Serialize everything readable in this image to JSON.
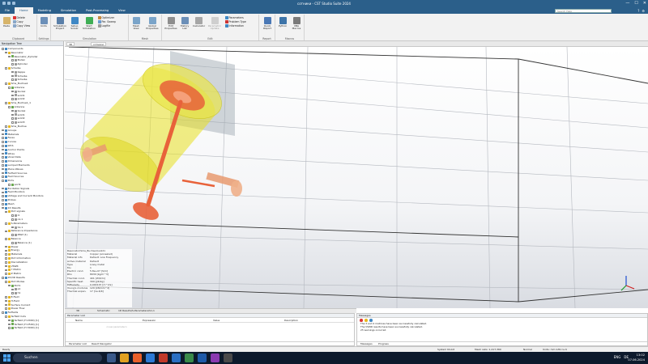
{
  "titlebar": {
    "title": "сотники - CST Studio Suite 2024",
    "minimize": "—",
    "maximize": "☐",
    "close": "✕"
  },
  "menu": {
    "items": [
      "File",
      "Home",
      "Modeling",
      "Simulation",
      "Post-Processing",
      "View"
    ],
    "active_index": 1,
    "search_placeholder": "Search Help"
  },
  "ribbon": {
    "groups": {
      "clipboard": {
        "label": "Clipboard",
        "paste": "Paste",
        "delete": "Delete",
        "copy": "Copy",
        "copy_view": "Copy View"
      },
      "settings": {
        "label": "Settings",
        "units": "Units"
      },
      "simulation": {
        "label": "Simulation",
        "project": "Simulation Project",
        "setup_solver": "Setup Solver",
        "start_simulation": "Start Simulation",
        "optimizer": "Optimizer",
        "par_sweep": "Par. Sweep",
        "logfile": "Logfile"
      },
      "mesh": {
        "label": "Mesh",
        "mesh_view": "Mesh View",
        "global_properties": "Global Properties"
      },
      "edit": {
        "label": "Edit",
        "edit_properties": "Edit Properties",
        "history_list": "History List",
        "calculator": "Calculator",
        "parametric_update": "Parametric Update",
        "parameters": "Parameters",
        "problem_type": "Problem Type",
        "information": "Information"
      },
      "report": {
        "label": "Report",
        "quick_report": "Quick Report"
      },
      "macros": {
        "label": "Macros",
        "python": "Python",
        "vba_macros": "VBA Macros"
      }
    }
  },
  "navtree": {
    "header": "Navigation Tree",
    "items": [
      {
        "label": "Components",
        "depth": 0
      },
      {
        "label": "Resonator",
        "depth": 1
      },
      {
        "label": "Resonator_Zylinder",
        "depth": 2
      },
      {
        "label": "Boden",
        "depth": 3
      },
      {
        "label": "Zylinder",
        "depth": 3
      },
      {
        "label": "Scheibe",
        "depth": 1
      },
      {
        "label": "Kappe",
        "depth": 3
      },
      {
        "label": "Scheibe",
        "depth": 3
      },
      {
        "label": "Scheibe",
        "depth": 3
      },
      {
        "label": "Sma_Buchse1",
        "depth": 1
      },
      {
        "label": "Antenne",
        "depth": 2
      },
      {
        "label": "Sockel",
        "depth": 3
      },
      {
        "label": "solid1",
        "depth": 3
      },
      {
        "label": "solid2",
        "depth": 3
      },
      {
        "label": "Sma_Buchse1_1",
        "depth": 1
      },
      {
        "label": "Antenne",
        "depth": 2
      },
      {
        "label": "Sockel",
        "depth": 3
      },
      {
        "label": "solid1",
        "depth": 3
      },
      {
        "label": "solid2",
        "depth": 3
      },
      {
        "label": "solid3",
        "depth": 3
      },
      {
        "label": "Sma_Buchse",
        "depth": 1
      },
      {
        "label": "Groups",
        "depth": 0
      },
      {
        "label": "Materials",
        "depth": 0
      },
      {
        "label": "Faces",
        "depth": 0
      },
      {
        "label": "Curves",
        "depth": 0
      },
      {
        "label": "WCS",
        "depth": 0
      },
      {
        "label": "Anchor Points",
        "depth": 0
      },
      {
        "label": "Wires",
        "depth": 0
      },
      {
        "label": "Voxel Data",
        "depth": 0
      },
      {
        "label": "Dimensions",
        "depth": 0
      },
      {
        "label": "Lumped Elements",
        "depth": 0
      },
      {
        "label": "Plane Waves",
        "depth": 0
      },
      {
        "label": "Farfield Sources",
        "depth": 0
      },
      {
        "label": "Field Sources",
        "depth": 0
      },
      {
        "label": "Ports",
        "depth": 0
      },
      {
        "label": "port1",
        "depth": 2
      },
      {
        "label": "Excitation Signals",
        "depth": 0
      },
      {
        "label": "Field Monitors",
        "depth": 0
      },
      {
        "label": "Voltage and Current Monitors",
        "depth": 0
      },
      {
        "label": "Probes",
        "depth": 0
      },
      {
        "label": "Mesh",
        "depth": 0
      },
      {
        "label": "1D Results",
        "depth": 0
      },
      {
        "label": "Port signals",
        "depth": 1
      },
      {
        "label": "i1",
        "depth": 3
      },
      {
        "label": "o1,1",
        "depth": 3
      },
      {
        "label": "S-Parameters",
        "depth": 1
      },
      {
        "label": "S1,1",
        "depth": 3
      },
      {
        "label": "Reference Impedance",
        "depth": 1
      },
      {
        "label": "ZRef (1)",
        "depth": 3
      },
      {
        "label": "Balance",
        "depth": 1
      },
      {
        "label": "Balance (1)",
        "depth": 3
      },
      {
        "label": "Power",
        "depth": 1
      },
      {
        "label": "Energy",
        "depth": 1
      },
      {
        "label": "Materials",
        "depth": 1
      },
      {
        "label": "Port Information",
        "depth": 1
      },
      {
        "label": "Discretization",
        "depth": 1
      },
      {
        "label": "VSWR",
        "depth": 1
      },
      {
        "label": "Y Matrix",
        "depth": 1
      },
      {
        "label": "Z Matrix",
        "depth": 1
      },
      {
        "label": "2D/3D Results",
        "depth": 0
      },
      {
        "label": "Port Modes",
        "depth": 1
      },
      {
        "label": "Port1",
        "depth": 2
      },
      {
        "label": "e1",
        "depth": 3
      },
      {
        "label": "h1",
        "depth": 3
      },
      {
        "label": "E-Field",
        "depth": 1
      },
      {
        "label": "H-Field",
        "depth": 1
      },
      {
        "label": "Surface Current",
        "depth": 1
      },
      {
        "label": "Power Flow",
        "depth": 1
      },
      {
        "label": "Farfields",
        "depth": 0
      },
      {
        "label": "farfield Cuts",
        "depth": 1
      },
      {
        "label": "farfield (f=2000) [1]",
        "depth": 2
      },
      {
        "label": "farfield (f=2500) [1]",
        "depth": 2
      },
      {
        "label": "farfield (f=3000) [1]",
        "depth": 2
      }
    ]
  },
  "viewtabs": [
    "3D",
    "сотники"
  ],
  "properties": {
    "path": "Resonator\\Sma_Buchse1\\solid1",
    "rows": [
      {
        "k": "Material",
        "v": "Copper (annealed)"
      },
      {
        "k": "Material info",
        "v": "Default: Low Frequency"
      },
      {
        "k": "Active material",
        "v": "Default"
      },
      {
        "k": "Type",
        "v": "Lossy metal"
      },
      {
        "k": "Mu",
        "v": "1"
      },
      {
        "k": "Electric cond.",
        "v": "5.8e+07 [S/m]"
      },
      {
        "k": "Rho",
        "v": "8930 [kg/m^3]"
      },
      {
        "k": "Thermal cond.",
        "v": "401 [W/K/m]"
      },
      {
        "k": "Specific heat",
        "v": "390 [J/K/kg]"
      },
      {
        "k": "Diffusivity",
        "v": "0.000115 [m^2/s]"
      },
      {
        "k": "Young's modulus",
        "v": "120 [kN/mm^2]"
      },
      {
        "k": "Thermal expan.",
        "v": "17 [1e-6/K]"
      }
    ]
  },
  "bottom_tabs": [
    "3D",
    "Schematic",
    "1D Results\\S-Parameters\\S1,1"
  ],
  "parameter_list": {
    "title": "Parameter List",
    "columns": [
      "Name",
      "Expression",
      "Value",
      "Description"
    ],
    "new_row": "<new parameter>",
    "tabs": [
      "Parameter List",
      "Result Navigator"
    ]
  },
  "messages": {
    "title": "Messages",
    "lines": [
      "The 3 and 4 matrices have been successfully calculated.",
      "The VSWR results have been successfully calculated.",
      "25 warnings occurred."
    ],
    "tabs": [
      "Messages",
      "Progress"
    ]
  },
  "statusbar": {
    "left": "Ready",
    "items": [
      "System 64-bit",
      "Mesh cells: 1,417,360",
      "Normal",
      "Units: mm GHz ns K"
    ]
  },
  "taskbar": {
    "search_label": "Suchen",
    "tray": [
      "ENG",
      "DE"
    ],
    "time": "13:02",
    "date": "07.06.2024"
  },
  "colors": {
    "accent": "#2b5f8a",
    "cylinder": "#e8e020",
    "copper": "#e8623a"
  }
}
